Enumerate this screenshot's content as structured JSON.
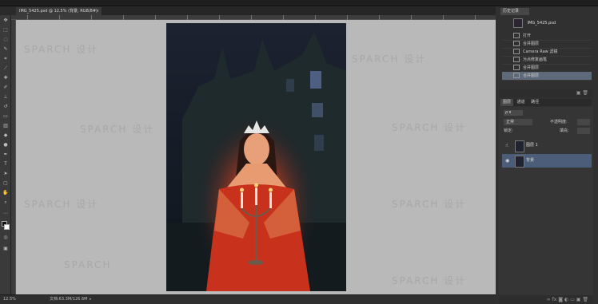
{
  "document": {
    "tab_title": "IMG_5425.psd @ 12.5% (背景, RGB/8#)",
    "close_glyph": "×"
  },
  "watermark": {
    "text": "SPARCH 设计",
    "short": "SPARCH"
  },
  "status": {
    "zoom": "12.5%",
    "doc_size": "文档:63.3M/126.6M"
  },
  "history": {
    "tab_label": "历史记录",
    "snapshot_name": "IMG_5425.psd",
    "items": [
      {
        "label": "打开",
        "selected": false
      },
      {
        "label": "合并图层",
        "selected": false
      },
      {
        "label": "Camera Raw 滤镜",
        "selected": false
      },
      {
        "label": "污点修复画笔",
        "selected": false
      },
      {
        "label": "合并图层",
        "selected": false
      },
      {
        "label": "合并图层",
        "selected": true
      }
    ]
  },
  "layers": {
    "tab_labels": [
      "图层",
      "通道",
      "路径"
    ],
    "blend_mode": "正常",
    "opacity_label": "不透明度:",
    "lock_label": "锁定:",
    "fill_label": "填充:",
    "items": [
      {
        "name": "图层 1",
        "selected": false
      },
      {
        "name": "背景",
        "selected": true
      }
    ]
  },
  "colors": {
    "selection": "#4b5d78",
    "canvas_gray": "#b9b9b9"
  }
}
